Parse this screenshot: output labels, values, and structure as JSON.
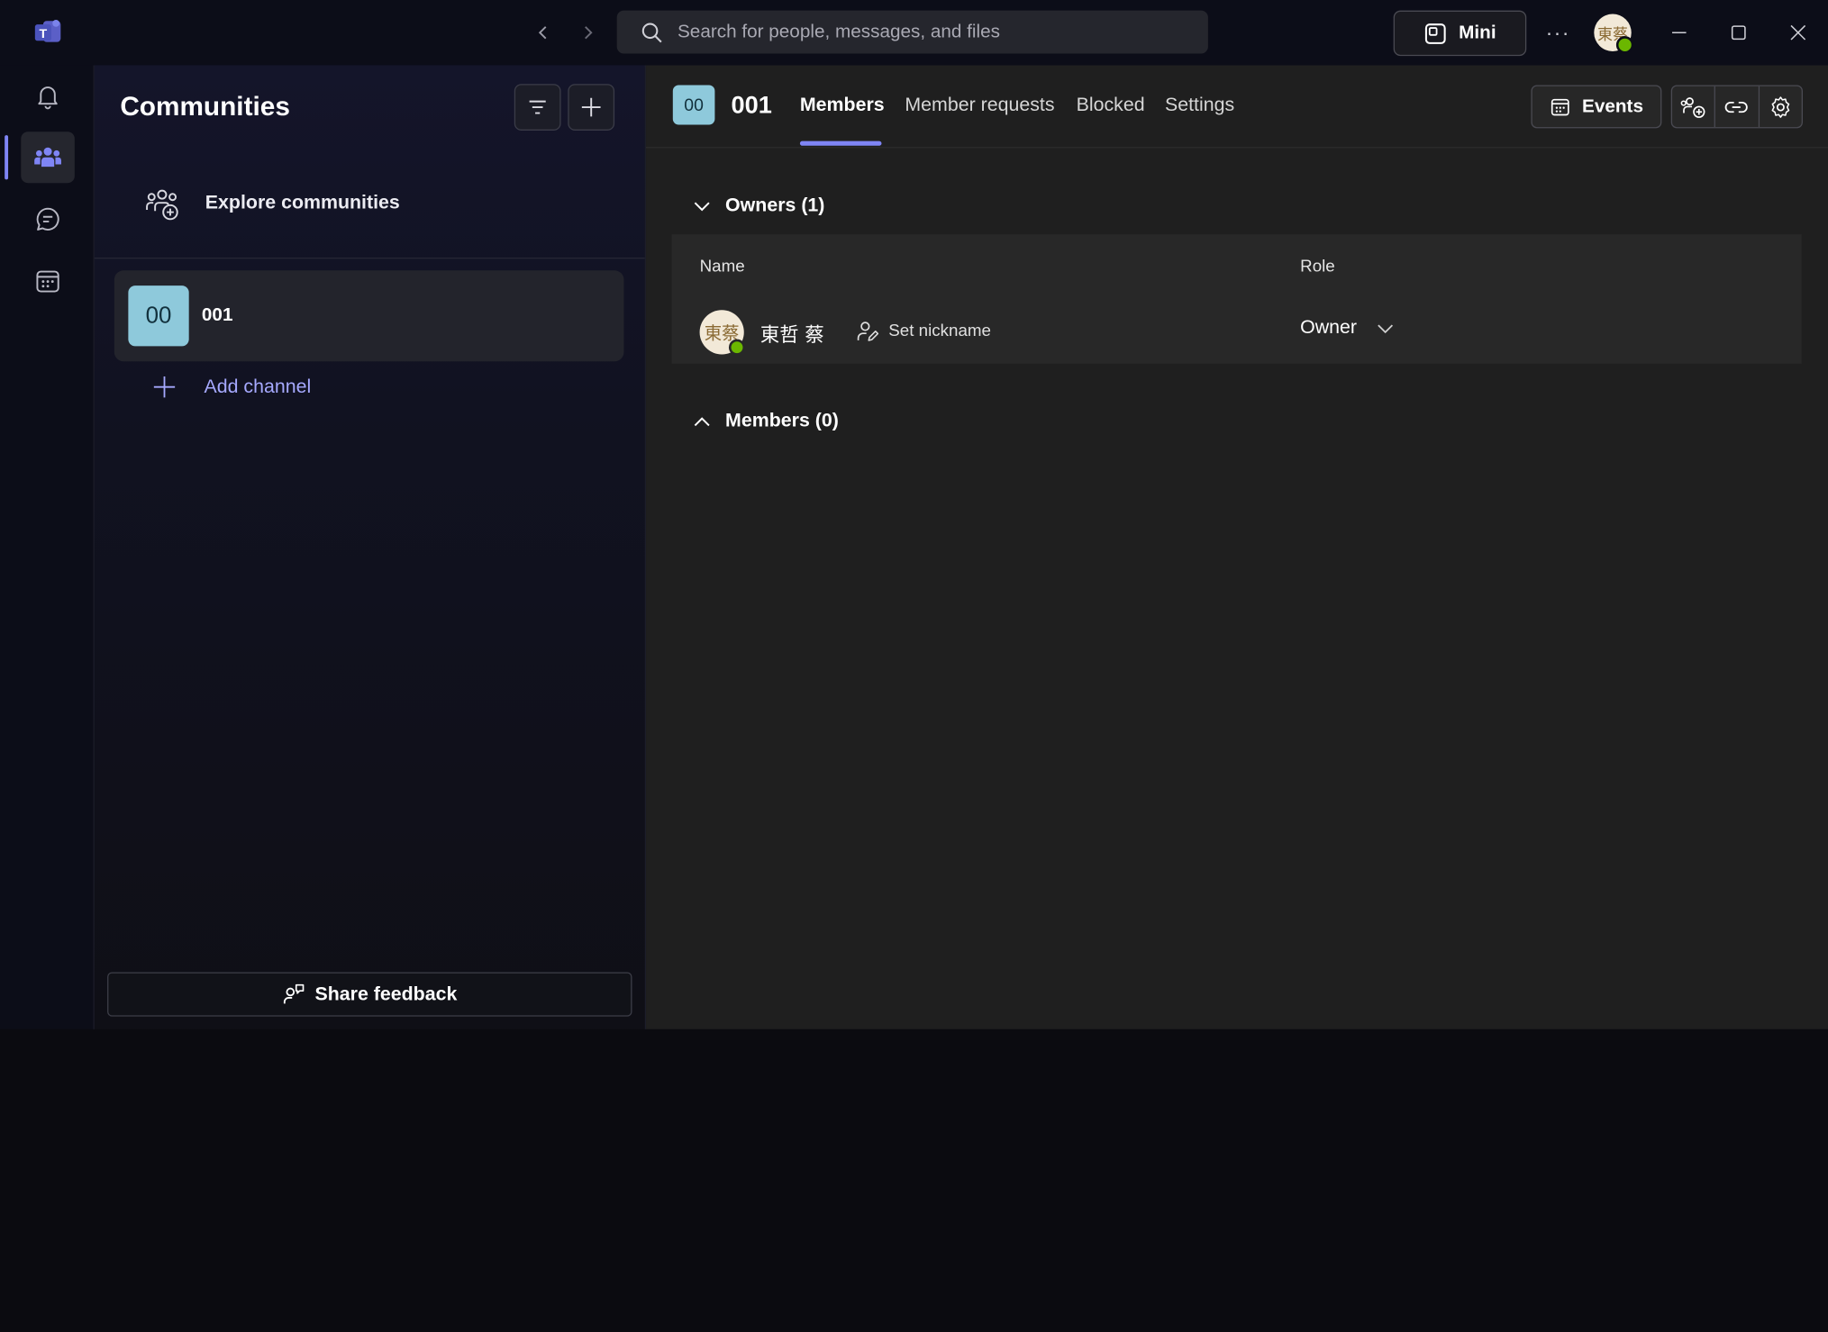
{
  "titlebar": {
    "search_placeholder": "Search for people, messages, and files",
    "mini_label": "Mini",
    "more_label": "···",
    "user_initials": "東蔡"
  },
  "rail": {
    "items": [
      {
        "name": "activity",
        "icon": "bell-icon"
      },
      {
        "name": "communities",
        "icon": "people-icon",
        "active": true
      },
      {
        "name": "chat",
        "icon": "chat-icon"
      },
      {
        "name": "calendar",
        "icon": "calendar-icon"
      }
    ]
  },
  "communities_panel": {
    "title": "Communities",
    "explore_label": "Explore communities",
    "community": {
      "tile": "00",
      "name": "001"
    },
    "add_channel_label": "Add channel",
    "share_feedback_label": "Share feedback"
  },
  "main": {
    "tile": "00",
    "name": "001",
    "tabs": [
      {
        "label": "Members",
        "active": true
      },
      {
        "label": "Member requests"
      },
      {
        "label": "Blocked"
      },
      {
        "label": "Settings"
      }
    ],
    "events_label": "Events",
    "owners_section": {
      "title": "Owners (1)",
      "columns": {
        "name": "Name",
        "role": "Role"
      },
      "rows": [
        {
          "avatar": "東蔡",
          "name": "東哲 蔡",
          "nickname_action": "Set nickname",
          "role": "Owner"
        }
      ]
    },
    "members_section": {
      "title": "Members (0)"
    }
  },
  "colors": {
    "accent": "#7f85f5",
    "community_tile": "#8ec9db",
    "presence_available": "#6bb700",
    "link": "#a6a9ff"
  }
}
